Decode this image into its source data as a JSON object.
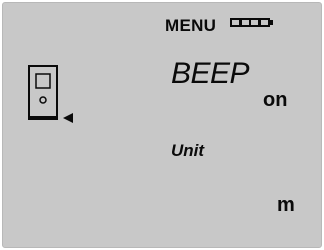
{
  "menu": {
    "title": "MENU"
  },
  "battery": {
    "level_cells": 4,
    "total_cells": 4
  },
  "beep": {
    "label": "BEEP",
    "value": "on"
  },
  "unit": {
    "label": "Unit",
    "value": "m"
  },
  "icons": {
    "device": "device-measure-rear-reference-icon",
    "battery": "battery-full-icon"
  },
  "colors": {
    "lcd_background": "#c8c8c8",
    "lcd_foreground": "#0a0a0a"
  }
}
